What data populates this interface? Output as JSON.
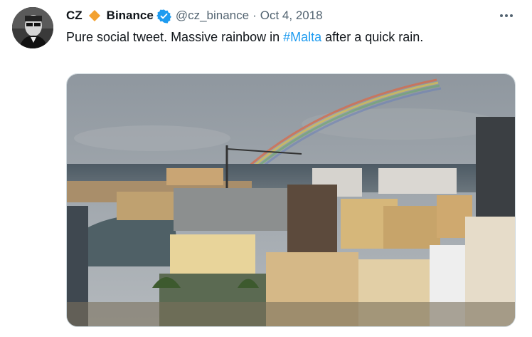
{
  "author": {
    "name_part1": "CZ",
    "name_part2": "Binance",
    "handle": "@cz_binance",
    "date": "Oct 4, 2018",
    "verified": true,
    "diamond_color": "#f3a12f",
    "verified_color": "#1d9bf0"
  },
  "tweet": {
    "text_before": "Pure social tweet. Massive rainbow in ",
    "hashtag": "#Malta",
    "text_after": " after a quick rain."
  },
  "icons": {
    "more": "more-horizontal-icon",
    "verified": "verified-badge-icon",
    "diamond": "orange-diamond-emoji"
  },
  "media": {
    "description_type": "photo"
  },
  "colors": {
    "link": "#1d9bf0",
    "secondary_text": "#536471"
  }
}
